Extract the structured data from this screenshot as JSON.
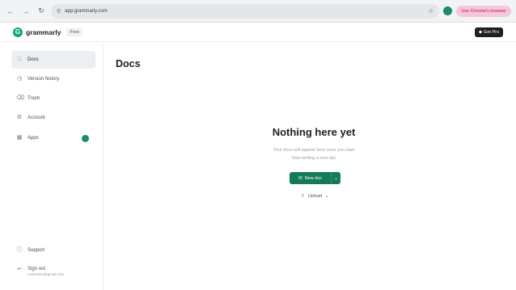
{
  "browser": {
    "url": "app.grammarly.com",
    "profile_action": "Use Chrome's browser"
  },
  "header": {
    "brand": "grammarly",
    "plan": "Free",
    "upgrade_label": "Get Pro"
  },
  "sidebar": {
    "items": [
      {
        "label": "Docs",
        "icon": "doc-icon"
      },
      {
        "label": "Version history",
        "icon": "clock-icon"
      },
      {
        "label": "Trash",
        "icon": "trash-icon"
      },
      {
        "label": "Account",
        "icon": "gear-icon"
      },
      {
        "label": "Apps",
        "icon": "grid-icon"
      }
    ],
    "support": "Support",
    "sign_out": "Sign out",
    "email": "username@gmail.com"
  },
  "main": {
    "title": "Docs",
    "empty_title": "Nothing here yet",
    "empty_line1": "Your docs will appear here once you start",
    "empty_line2": "Start writing a new doc",
    "new_doc": "New doc",
    "upload": "Upload"
  },
  "colors": {
    "accent": "#15795b",
    "brand": "#11a683"
  }
}
